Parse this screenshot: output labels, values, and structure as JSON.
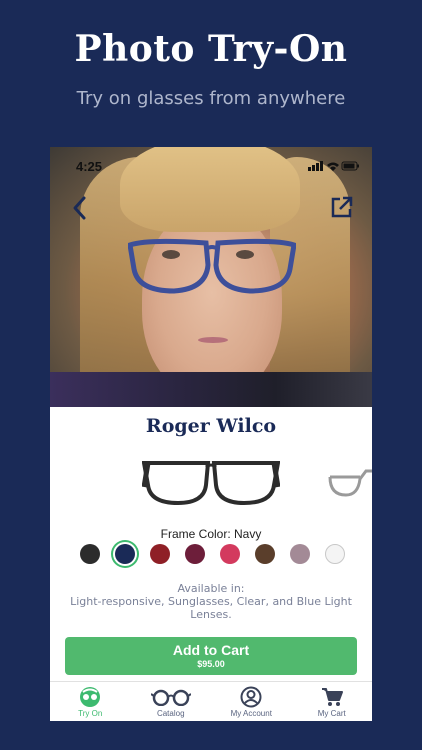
{
  "promo": {
    "title": "Photo Try-On",
    "subtitle": "Try on glasses from anywhere"
  },
  "status_bar": {
    "time": "4:25"
  },
  "product": {
    "name": "Roger Wilco",
    "frame_color_label": "Frame Color: Navy",
    "swatches": [
      {
        "name": "black",
        "color": "#2c2c2c"
      },
      {
        "name": "navy",
        "color": "#1a2a57",
        "selected": true
      },
      {
        "name": "red",
        "color": "#8f1f26"
      },
      {
        "name": "burgundy",
        "color": "#6d1e3a"
      },
      {
        "name": "pink",
        "color": "#d33a5e"
      },
      {
        "name": "brown",
        "color": "#5a3e2b"
      },
      {
        "name": "mauve",
        "color": "#a38a96"
      },
      {
        "name": "clear",
        "color": "#f4f4f4"
      }
    ],
    "availability_title": "Available in:",
    "availability_text": "Light-responsive, Sunglasses, Clear, and Blue Light Lenses.",
    "add_to_cart_label": "Add to Cart",
    "price": "$95.00"
  },
  "tabs": [
    {
      "label": "Try On",
      "icon": "try-on-icon",
      "active": true
    },
    {
      "label": "Catalog",
      "icon": "glasses-icon"
    },
    {
      "label": "My Account",
      "icon": "account-icon"
    },
    {
      "label": "My Cart",
      "icon": "cart-icon"
    }
  ],
  "colors": {
    "background": "#1a2a57",
    "accent_green": "#51b96e",
    "brand_navy": "#1a2a57"
  }
}
